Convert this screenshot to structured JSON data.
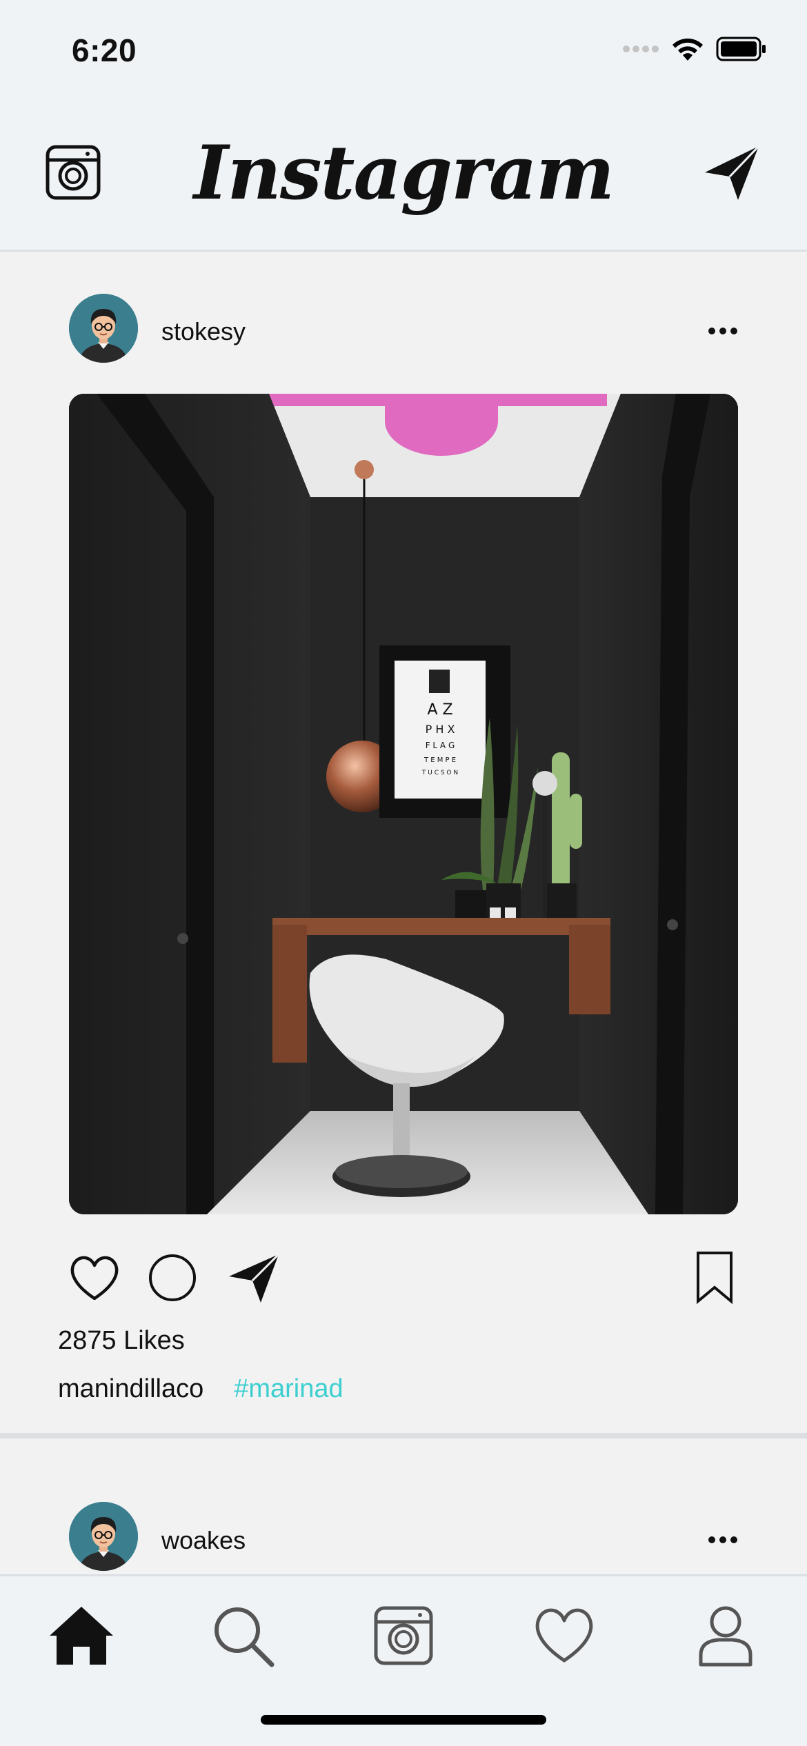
{
  "status_bar": {
    "time": "6:20",
    "icons": [
      "cellular-dots-icon",
      "wifi-icon",
      "battery-icon"
    ]
  },
  "header": {
    "logo_text": "Instagram",
    "left_icon": "camera-icon",
    "right_icon": "send-icon"
  },
  "posts": [
    {
      "username": "stokesy",
      "avatar": "avatar-man-glasses",
      "image": "dark-desk-nook-photo",
      "likes_text": "2875 Likes",
      "caption_user": "manindillaco",
      "caption_hashtag": "#marinad",
      "actions": [
        "heart-icon",
        "comment-icon",
        "send-icon",
        "bookmark-icon"
      ]
    },
    {
      "username": "woakes",
      "avatar": "avatar-man-glasses"
    }
  ],
  "tab_bar": {
    "tabs": [
      "home-icon",
      "search-icon",
      "camera-icon",
      "heart-icon",
      "profile-icon"
    ],
    "active": "home-icon"
  },
  "colors": {
    "hashtag": "#3dcfd0",
    "bar_background": "#f0f3f6",
    "feed_background": "#f2f2f2",
    "avatar_background": "#3b7f8f",
    "image_ceiling_accent": "#e06ac0"
  }
}
